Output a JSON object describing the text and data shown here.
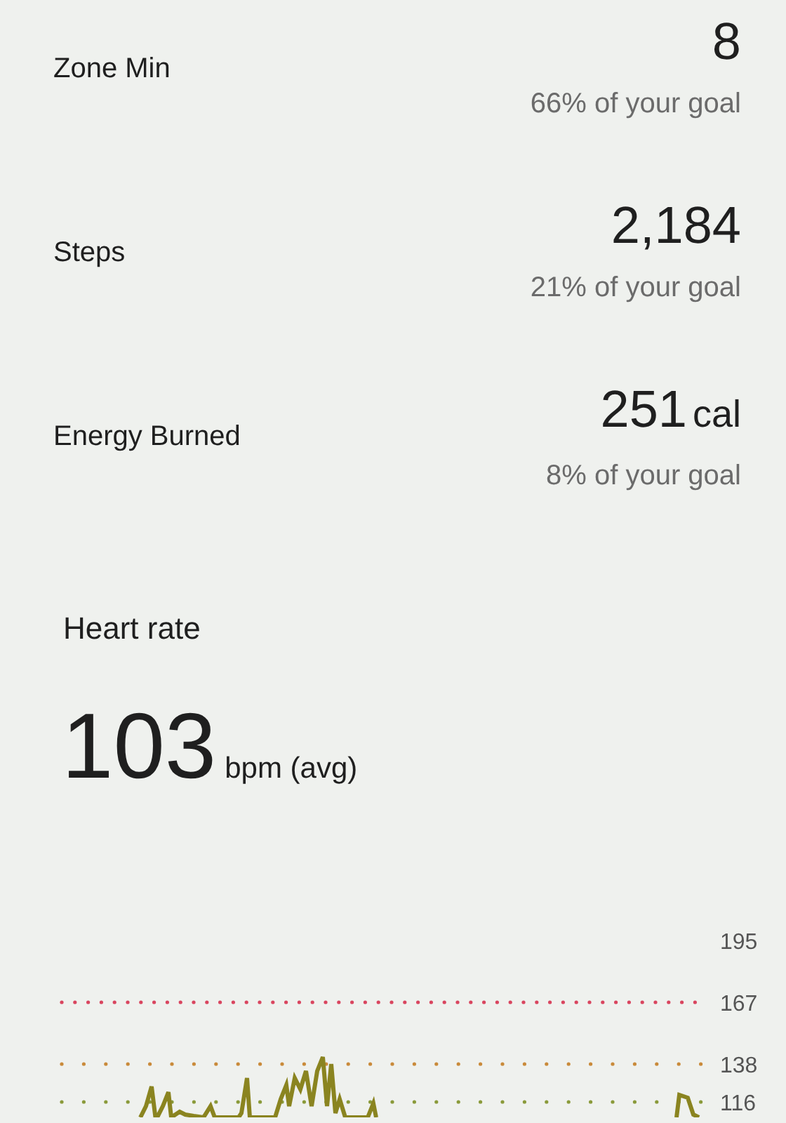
{
  "metrics": [
    {
      "label": "Zone Min",
      "value": "8",
      "goal": "66% of your goal"
    },
    {
      "label": "Steps",
      "value": "2,184",
      "goal": "21% of your goal"
    },
    {
      "label": "Energy Burned",
      "value": "251",
      "unit": "cal",
      "goal": "8% of your goal"
    }
  ],
  "heart_rate": {
    "title": "Heart rate",
    "value": "103",
    "unit": "bpm (avg)",
    "zones": [
      {
        "label": "195",
        "kind": "label"
      },
      {
        "label": "167",
        "kind": "line",
        "color": "#d9455f"
      },
      {
        "label": "138",
        "kind": "line",
        "color": "#c98a3a"
      },
      {
        "label": "116",
        "kind": "line",
        "color": "#8a9a3a"
      }
    ]
  }
}
